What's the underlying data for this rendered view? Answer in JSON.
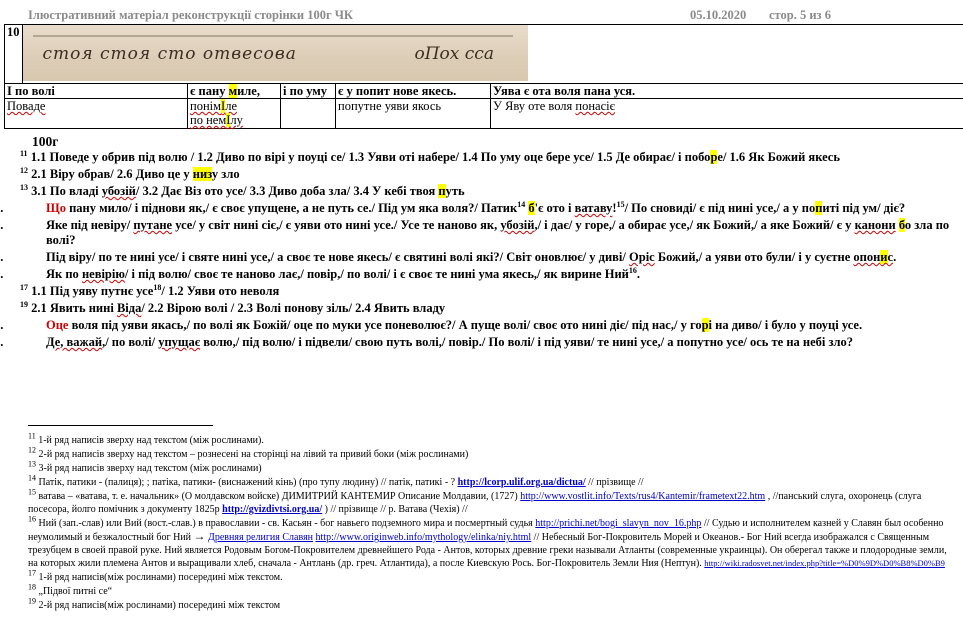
{
  "header": {
    "title": "Ілюстративний матеріал  реконструкції сторінки 100г ЧК",
    "date": "05.10.2020",
    "page": "стор. 5 из 6"
  },
  "table": {
    "row_number": "10",
    "manuscript_text_1": "стоя стоя сто отвесова",
    "manuscript_text_2": "оПох сса",
    "header_cells": [
      "І по волі",
      "є пану мИле,",
      "і по уму",
      "є у попит нове якесь.",
      "Уява є ота воля пана уся."
    ],
    "value_cells": [
      "Поваде",
      "понімІле по нем І лу",
      "",
      "попутне уяви якось",
      "У Яву оте воля понасіє"
    ]
  },
  "section_title": "100г",
  "lines": [
    "11 1.1 Поведе у обрив під волю / 1.2 Диво по вірі у поуці се/ 1.3 Уяви оті набере/ 1.4 По уму оце бере усе/ 1.5 Де обирає/ і поборе/ 1.6 Як Божий якесь",
    "12 2.1 Віру обрав/ 2.6 Диво це у низу зло",
    "13 3.1 По владі убозій/ 3.2 Дає Віз ото усе/ 3.3 Диво доба зла/ 3.4 У кебі твоя путь",
    "1. Що пану мило/ і піднови як,/ є своє упущене, а не путь се./ Під ум яка воля?/ Патик14 б'є ото і ватаву!15/ По сновиді/ є під нині усе,/ а у попиті під ум/ діє?",
    "2. Яке під невіру/ путане усе/ у світ нині сіє,/ є уяви ото нині усе./ Усе те наново як, убозій,/ і дає/ у горе,/ а обирає усе,/ як Божий,/ а яке Божий/ є у канони бо зла по волі?",
    "3. Під віру/ по те нині усе/ і святе нині усе,/ а своє те нове якесь/ є святині волі які?/ Світ оновлює/ у диві/ Оріс Божий,/ а уяви ото були/ і у суєтне опонис.",
    "4. Як по невірію/ і під волю/ своє те наново лає,/ повір,/ по волі/ і є своє те нині ума якесь,/ як вирине Ний16.",
    "17 1.1 Під уяву путнє усе18/ 1.2 Уяви ото неволя",
    "19 2.1 Явить нині Віда/ 2.2 Вірою волі / 2.3 Волі понову зіль/ 2.4 Явить владу",
    "5. Оце воля під уяви якась,/ по волі як Божій/ оце по муки усе поневолює?/ А пуще волі/ своє ото нині діє/ під нас,/ у горі на диво/ і було у поуці усе.",
    "6. Де, важай,/ по волі/ упущає волю,/ під волю/ і підвели/ свою путь волі,/ повір./ По волі/ і під уяви/ те нині усе,/ а попутно усе/ ось те на небі зло?"
  ],
  "footnotes": {
    "f11": "1-й ряд написів зверху над текстом (між рослинами).",
    "f12": "2-й ряд написів зверху над текстом – рознесені на сторінці на лівий та привий боки (між рослинами)",
    "f13": "3-й ряд написів зверху над текстом (між рослинами)",
    "f14_text": "Патік, патики - (палиця); ; патіка, патики- (виснажений кінь) (про тупу людину) // патік, патикі - ?",
    "f14_link": "http://lcorp.ulif.org.ua/dictua/",
    "f14_tail": "//  прізвище //",
    "f15_text": "ватава – «ватава, т. е. начальник» (О молдавском войске)  ДИМИТРИЙ КАНТЕМИР Описание Молдавии, (1727)",
    "f15_link": "http://www.vostlit.info/Texts/rus4/Kantemir/frametext22.htm",
    "f15_text2": ", //панський слуга, охоронець (слуга посесора, йолго помічник з документу 1825р",
    "f15_link2": "http://gvizdivtsi.org.ua/",
    "f15_tail": ") // прізвище // р. Ватава (Чехія) //",
    "f16_text": "Ний (зап.-слав) или Вий (вост.-слав.) в православии - св. Касьян - бог навьего подземного мира и посмертный судья",
    "f16_link": "http://prichi.net/bogi_slavyn_nov_16.php",
    "f16_text2": "// Судью и исполнителем казней у Славян был особенно неумолимый и безжалостный бог Ний",
    "f16_arrow": "→",
    "f16_link2": "Древняя религия Славян",
    "f16_link3": "http://www.originweb.info/mythology/elinka/niy.html",
    "f16_text3": "//  Небесный Бог-Покровитель Морей и Океанов.- Бог Ний всегда изображался с Священным трезубцем в своей правой руке. Ний является Родовым Богом-Покровителем древнейшего Рода - Антов, которых древние греки называли Атланты (современные украинцы). Он оберегал также и плодородные земли, на которых жили племена Антов и выращивали хлеб, сначала - Антлань (др. греч. Атлантида), а после Киевскую Рось. Бог-Покровитель Земли Ния (Нептун).",
    "f16_link4": "http://wiki.radosvet.net/index.php?title=%D0%9D%D0%B8%D0%B9",
    "f17": "1-й ряд написів(між рослинами) посередині між текстом.",
    "f18": "„Підвої питні се“",
    "f19": "2-й ряд написів(між рослинами) посередині між текстом"
  }
}
